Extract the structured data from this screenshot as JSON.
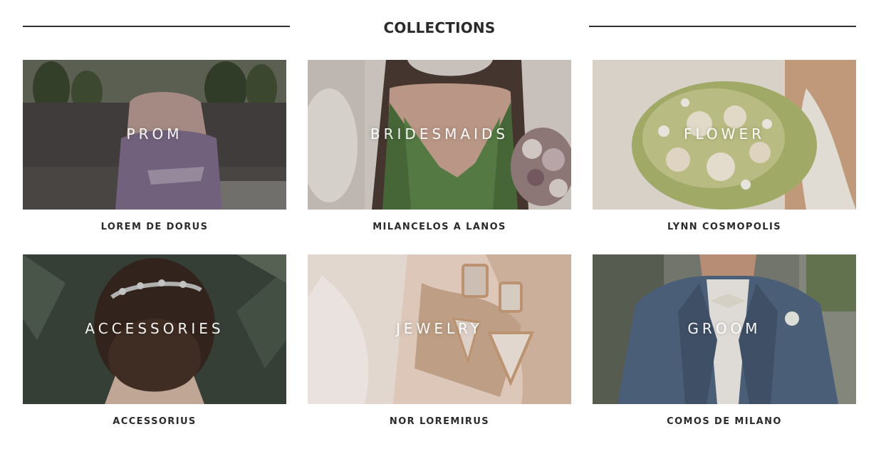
{
  "header": {
    "title": "COLLECTIONS"
  },
  "collections": [
    {
      "overlay": "PROM",
      "caption": "LOREM DE DORUS"
    },
    {
      "overlay": "BRIDESMAIDS",
      "caption": "MILANCELOS A LANOS"
    },
    {
      "overlay": "FLOWER",
      "caption": "LYNN COSMOPOLIS"
    },
    {
      "overlay": "ACCESSORIES",
      "caption": "ACCESSORIUS"
    },
    {
      "overlay": "JEWELRY",
      "caption": "NOR LOREMIRUS"
    },
    {
      "overlay": "GROOM",
      "caption": "COMOS DE MILANO"
    }
  ]
}
